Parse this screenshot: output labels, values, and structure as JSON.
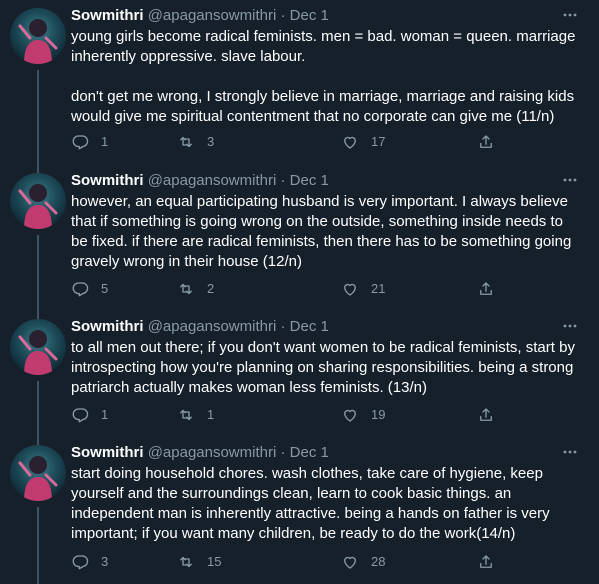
{
  "tweets": [
    {
      "name": "Sowmithri",
      "handle": "@apagansowmithri",
      "separator": "·",
      "date": "Dec 1",
      "text": "young girls become radical feminists. men = bad. woman = queen. marriage inherently oppressive. slave labour.\n\ndon't get me wrong, I strongly believe in marriage, marriage and raising kids would give me spiritual contentment that no corporate can give me (11/n)",
      "replies": "1",
      "retweets": "3",
      "likes": "17"
    },
    {
      "name": "Sowmithri",
      "handle": "@apagansowmithri",
      "separator": "·",
      "date": "Dec 1",
      "text": "however, an equal participating husband is very important. I always believe that if something is going wrong on the outside, something inside needs to be fixed. if there are radical feminists, then there has to be something going gravely wrong in their house (12/n)",
      "replies": "5",
      "retweets": "2",
      "likes": "21"
    },
    {
      "name": "Sowmithri",
      "handle": "@apagansowmithri",
      "separator": "·",
      "date": "Dec 1",
      "text": "to all men out there; if you don't want women to be radical feminists, start by introspecting how you're planning on sharing responsibilities. being a strong patriarch actually makes woman less feminists. (13/n)",
      "replies": "1",
      "retweets": "1",
      "likes": "19"
    },
    {
      "name": "Sowmithri",
      "handle": "@apagansowmithri",
      "separator": "·",
      "date": "Dec 1",
      "text": "start doing household chores. wash clothes, take care of hygiene, keep yourself and the surroundings clean, learn to cook basic things. an independent man is inherently attractive. being a hands on father is very important; if you want many children, be ready to do the work(14/n)",
      "replies": "3",
      "retweets": "15",
      "likes": "28"
    }
  ],
  "colors": {
    "background": "#15202b",
    "text": "#ffffff",
    "muted": "#8899a6",
    "thread_line": "#3d5466"
  },
  "icons": [
    "avatar-image",
    "more-icon",
    "reply-icon",
    "retweet-icon",
    "like-icon",
    "share-icon"
  ]
}
